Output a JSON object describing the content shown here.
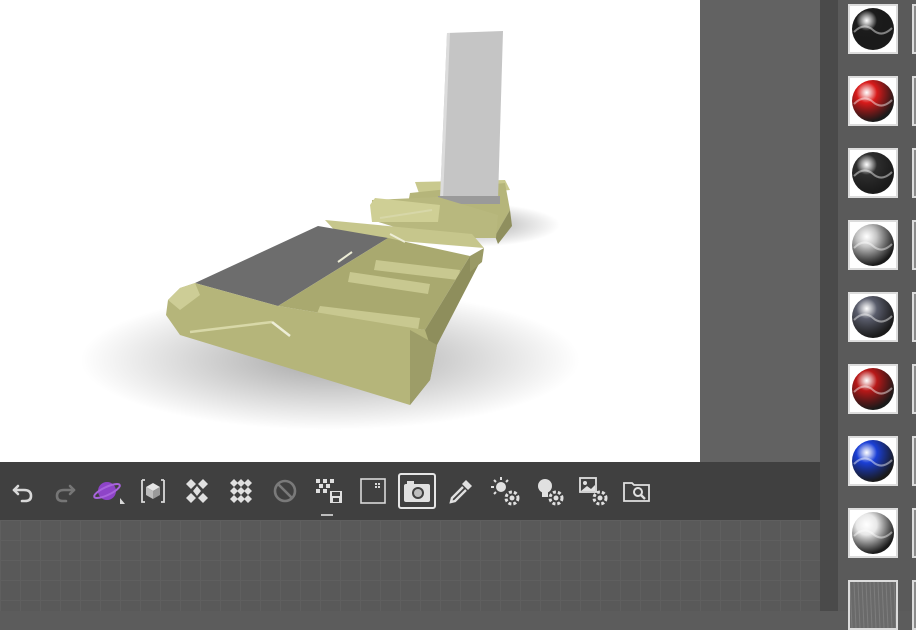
{
  "toolbar": {
    "tools": [
      {
        "name": "undo-button",
        "icon": "undo-arrow-icon"
      },
      {
        "name": "redo-button",
        "icon": "redo-arrow-icon",
        "disabled": true
      },
      {
        "name": "environment-button",
        "icon": "planet-icon",
        "accent": "#8e44c8"
      },
      {
        "name": "object-view-button",
        "icon": "cube-icon"
      },
      {
        "name": "diamond-grid-button",
        "icon": "diamond-grid-icon"
      },
      {
        "name": "checker-grid-button",
        "icon": "checker-grid-icon"
      },
      {
        "name": "disable-button",
        "icon": "no-sign-icon",
        "disabled": true
      },
      {
        "name": "grid-save-button",
        "icon": "grid-save-icon"
      },
      {
        "name": "frame-button",
        "icon": "frame-dot-icon"
      },
      {
        "name": "camera-button",
        "icon": "camera-icon",
        "active": true
      },
      {
        "name": "eyedropper-button",
        "icon": "eyedropper-icon"
      },
      {
        "name": "light-settings-button",
        "icon": "sun-gear-icon"
      },
      {
        "name": "bulb-settings-button",
        "icon": "bulb-gear-icon"
      },
      {
        "name": "image-settings-button",
        "icon": "image-gear-icon"
      },
      {
        "name": "find-file-button",
        "icon": "folder-search-icon"
      }
    ]
  },
  "materials": [
    {
      "name": "black-glossy",
      "color": "#1c1c1c"
    },
    {
      "name": "red-glossy",
      "color": "#d81a1a"
    },
    {
      "name": "dark-grey",
      "color": "#2e2e2e"
    },
    {
      "name": "silver",
      "color": "#c2c2c2"
    },
    {
      "name": "slate-grey",
      "color": "#5a5d6c"
    },
    {
      "name": "red-metallic",
      "color": "#b81818"
    },
    {
      "name": "blue-glossy",
      "color": "#1a3fd6"
    },
    {
      "name": "white-glossy",
      "color": "#e8e8e8"
    },
    {
      "name": "fabric-texture",
      "color": "#6a6a6a"
    }
  ],
  "colors": {
    "model_body": "#b8b87e",
    "model_shadow": "#8a8a5a",
    "model_panel": "#6d6d6d",
    "viewport_bg": "#ffffff"
  }
}
